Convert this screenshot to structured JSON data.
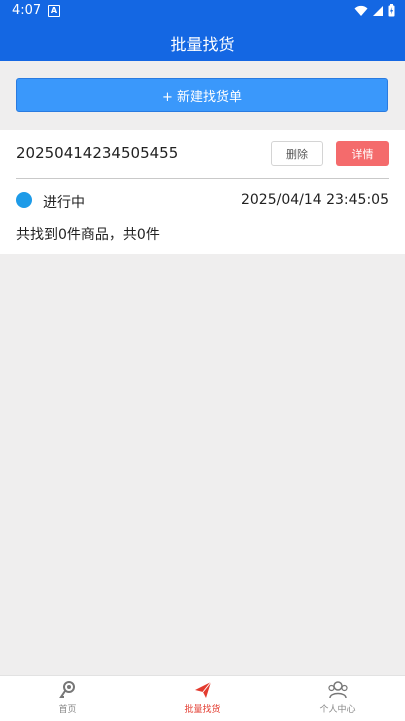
{
  "status_bar": {
    "time": "4:07",
    "a_icon_letter": "A"
  },
  "app_bar": {
    "title": "批量找货"
  },
  "new_order_button": {
    "label": "+ 新建找货单"
  },
  "orders": [
    {
      "id": "20250414234505455",
      "delete_label": "删除",
      "detail_label": "详情",
      "status": "进行中",
      "status_color": "#1e9be8",
      "timestamp": "2025/04/14 23:45:05",
      "summary": "共找到0件商品，共0件"
    }
  ],
  "tab_bar": {
    "tabs": [
      {
        "label": "首页",
        "icon": "home-icon",
        "active": false
      },
      {
        "label": "批量找货",
        "icon": "paper-plane-icon",
        "active": true
      },
      {
        "label": "个人中心",
        "icon": "user-center-icon",
        "active": false
      }
    ]
  },
  "colors": {
    "primary": "#1467e3",
    "button_blue": "#3a98fb",
    "detail_red": "#f46b6c",
    "active_tab": "#e33b2f"
  }
}
